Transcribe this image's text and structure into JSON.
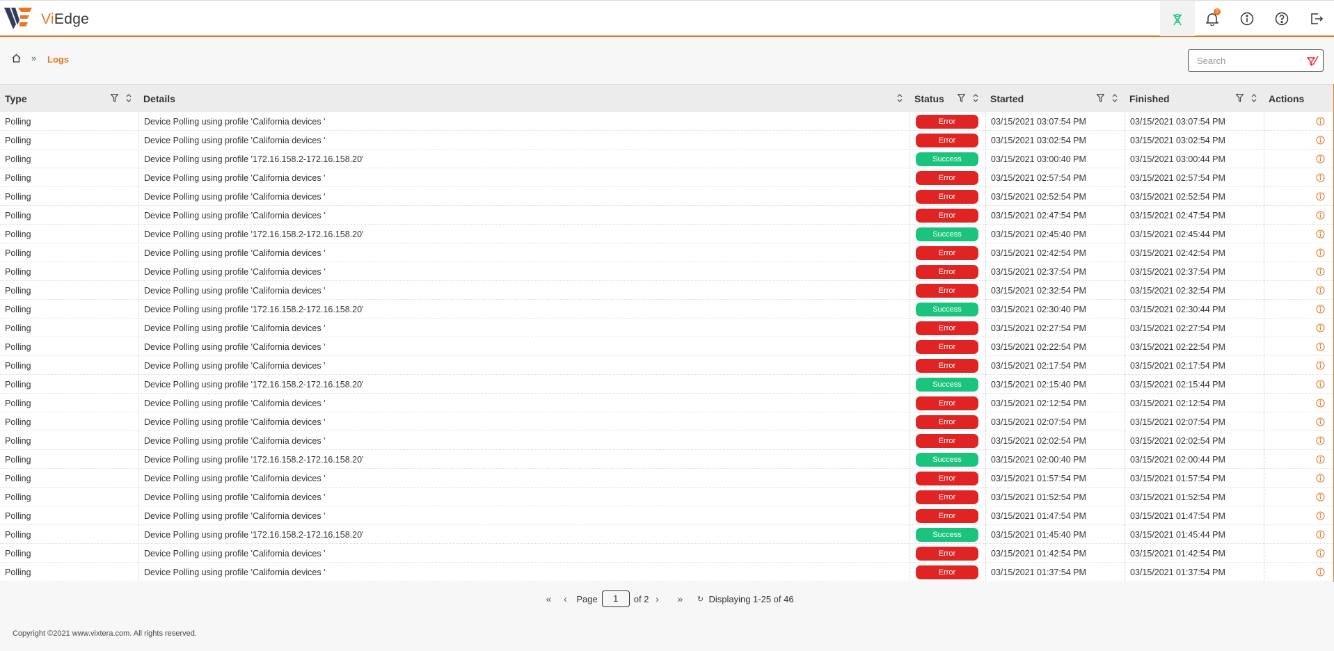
{
  "app": {
    "brand_prefix": "Vi",
    "brand_suffix": "Edge"
  },
  "header": {
    "icons": [
      "satellite-icon",
      "bell-icon",
      "info-icon",
      "help-icon",
      "logout-icon"
    ],
    "notification_count": "0"
  },
  "breadcrumb": {
    "current": "Logs",
    "separator": "»"
  },
  "search": {
    "placeholder": "Search"
  },
  "columns": {
    "type": "Type",
    "details": "Details",
    "status": "Status",
    "started": "Started",
    "finished": "Finished",
    "actions": "Actions"
  },
  "rows": [
    {
      "type": "Polling",
      "details": "Device Polling using profile 'California devices '",
      "status": "Error",
      "started": "03/15/2021 03:07:54 PM",
      "finished": "03/15/2021 03:07:54 PM"
    },
    {
      "type": "Polling",
      "details": "Device Polling using profile 'California devices '",
      "status": "Error",
      "started": "03/15/2021 03:02:54 PM",
      "finished": "03/15/2021 03:02:54 PM"
    },
    {
      "type": "Polling",
      "details": "Device Polling using profile '172.16.158.2-172.16.158.20'",
      "status": "Success",
      "started": "03/15/2021 03:00:40 PM",
      "finished": "03/15/2021 03:00:44 PM"
    },
    {
      "type": "Polling",
      "details": "Device Polling using profile 'California devices '",
      "status": "Error",
      "started": "03/15/2021 02:57:54 PM",
      "finished": "03/15/2021 02:57:54 PM"
    },
    {
      "type": "Polling",
      "details": "Device Polling using profile 'California devices '",
      "status": "Error",
      "started": "03/15/2021 02:52:54 PM",
      "finished": "03/15/2021 02:52:54 PM"
    },
    {
      "type": "Polling",
      "details": "Device Polling using profile 'California devices '",
      "status": "Error",
      "started": "03/15/2021 02:47:54 PM",
      "finished": "03/15/2021 02:47:54 PM"
    },
    {
      "type": "Polling",
      "details": "Device Polling using profile '172.16.158.2-172.16.158.20'",
      "status": "Success",
      "started": "03/15/2021 02:45:40 PM",
      "finished": "03/15/2021 02:45:44 PM"
    },
    {
      "type": "Polling",
      "details": "Device Polling using profile 'California devices '",
      "status": "Error",
      "started": "03/15/2021 02:42:54 PM",
      "finished": "03/15/2021 02:42:54 PM"
    },
    {
      "type": "Polling",
      "details": "Device Polling using profile 'California devices '",
      "status": "Error",
      "started": "03/15/2021 02:37:54 PM",
      "finished": "03/15/2021 02:37:54 PM"
    },
    {
      "type": "Polling",
      "details": "Device Polling using profile 'California devices '",
      "status": "Error",
      "started": "03/15/2021 02:32:54 PM",
      "finished": "03/15/2021 02:32:54 PM"
    },
    {
      "type": "Polling",
      "details": "Device Polling using profile '172.16.158.2-172.16.158.20'",
      "status": "Success",
      "started": "03/15/2021 02:30:40 PM",
      "finished": "03/15/2021 02:30:44 PM"
    },
    {
      "type": "Polling",
      "details": "Device Polling using profile 'California devices '",
      "status": "Error",
      "started": "03/15/2021 02:27:54 PM",
      "finished": "03/15/2021 02:27:54 PM"
    },
    {
      "type": "Polling",
      "details": "Device Polling using profile 'California devices '",
      "status": "Error",
      "started": "03/15/2021 02:22:54 PM",
      "finished": "03/15/2021 02:22:54 PM"
    },
    {
      "type": "Polling",
      "details": "Device Polling using profile 'California devices '",
      "status": "Error",
      "started": "03/15/2021 02:17:54 PM",
      "finished": "03/15/2021 02:17:54 PM"
    },
    {
      "type": "Polling",
      "details": "Device Polling using profile '172.16.158.2-172.16.158.20'",
      "status": "Success",
      "started": "03/15/2021 02:15:40 PM",
      "finished": "03/15/2021 02:15:44 PM"
    },
    {
      "type": "Polling",
      "details": "Device Polling using profile 'California devices '",
      "status": "Error",
      "started": "03/15/2021 02:12:54 PM",
      "finished": "03/15/2021 02:12:54 PM"
    },
    {
      "type": "Polling",
      "details": "Device Polling using profile 'California devices '",
      "status": "Error",
      "started": "03/15/2021 02:07:54 PM",
      "finished": "03/15/2021 02:07:54 PM"
    },
    {
      "type": "Polling",
      "details": "Device Polling using profile 'California devices '",
      "status": "Error",
      "started": "03/15/2021 02:02:54 PM",
      "finished": "03/15/2021 02:02:54 PM"
    },
    {
      "type": "Polling",
      "details": "Device Polling using profile '172.16.158.2-172.16.158.20'",
      "status": "Success",
      "started": "03/15/2021 02:00:40 PM",
      "finished": "03/15/2021 02:00:44 PM"
    },
    {
      "type": "Polling",
      "details": "Device Polling using profile 'California devices '",
      "status": "Error",
      "started": "03/15/2021 01:57:54 PM",
      "finished": "03/15/2021 01:57:54 PM"
    },
    {
      "type": "Polling",
      "details": "Device Polling using profile 'California devices '",
      "status": "Error",
      "started": "03/15/2021 01:52:54 PM",
      "finished": "03/15/2021 01:52:54 PM"
    },
    {
      "type": "Polling",
      "details": "Device Polling using profile 'California devices '",
      "status": "Error",
      "started": "03/15/2021 01:47:54 PM",
      "finished": "03/15/2021 01:47:54 PM"
    },
    {
      "type": "Polling",
      "details": "Device Polling using profile '172.16.158.2-172.16.158.20'",
      "status": "Success",
      "started": "03/15/2021 01:45:40 PM",
      "finished": "03/15/2021 01:45:44 PM"
    },
    {
      "type": "Polling",
      "details": "Device Polling using profile 'California devices '",
      "status": "Error",
      "started": "03/15/2021 01:42:54 PM",
      "finished": "03/15/2021 01:42:54 PM"
    },
    {
      "type": "Polling",
      "details": "Device Polling using profile 'California devices '",
      "status": "Error",
      "started": "03/15/2021 01:37:54 PM",
      "finished": "03/15/2021 01:37:54 PM"
    }
  ],
  "pagination": {
    "page_label": "Page",
    "current_page": "1",
    "of_label": "of 2",
    "display_text": "Displaying 1-25 of 46"
  },
  "footer": {
    "copyright": "Copyright ©2021 www.vixtera.com. All rights reserved."
  },
  "colors": {
    "accent": "#e87722",
    "error": "#e02424",
    "success": "#1bc47d",
    "satellite": "#1bc47d"
  }
}
